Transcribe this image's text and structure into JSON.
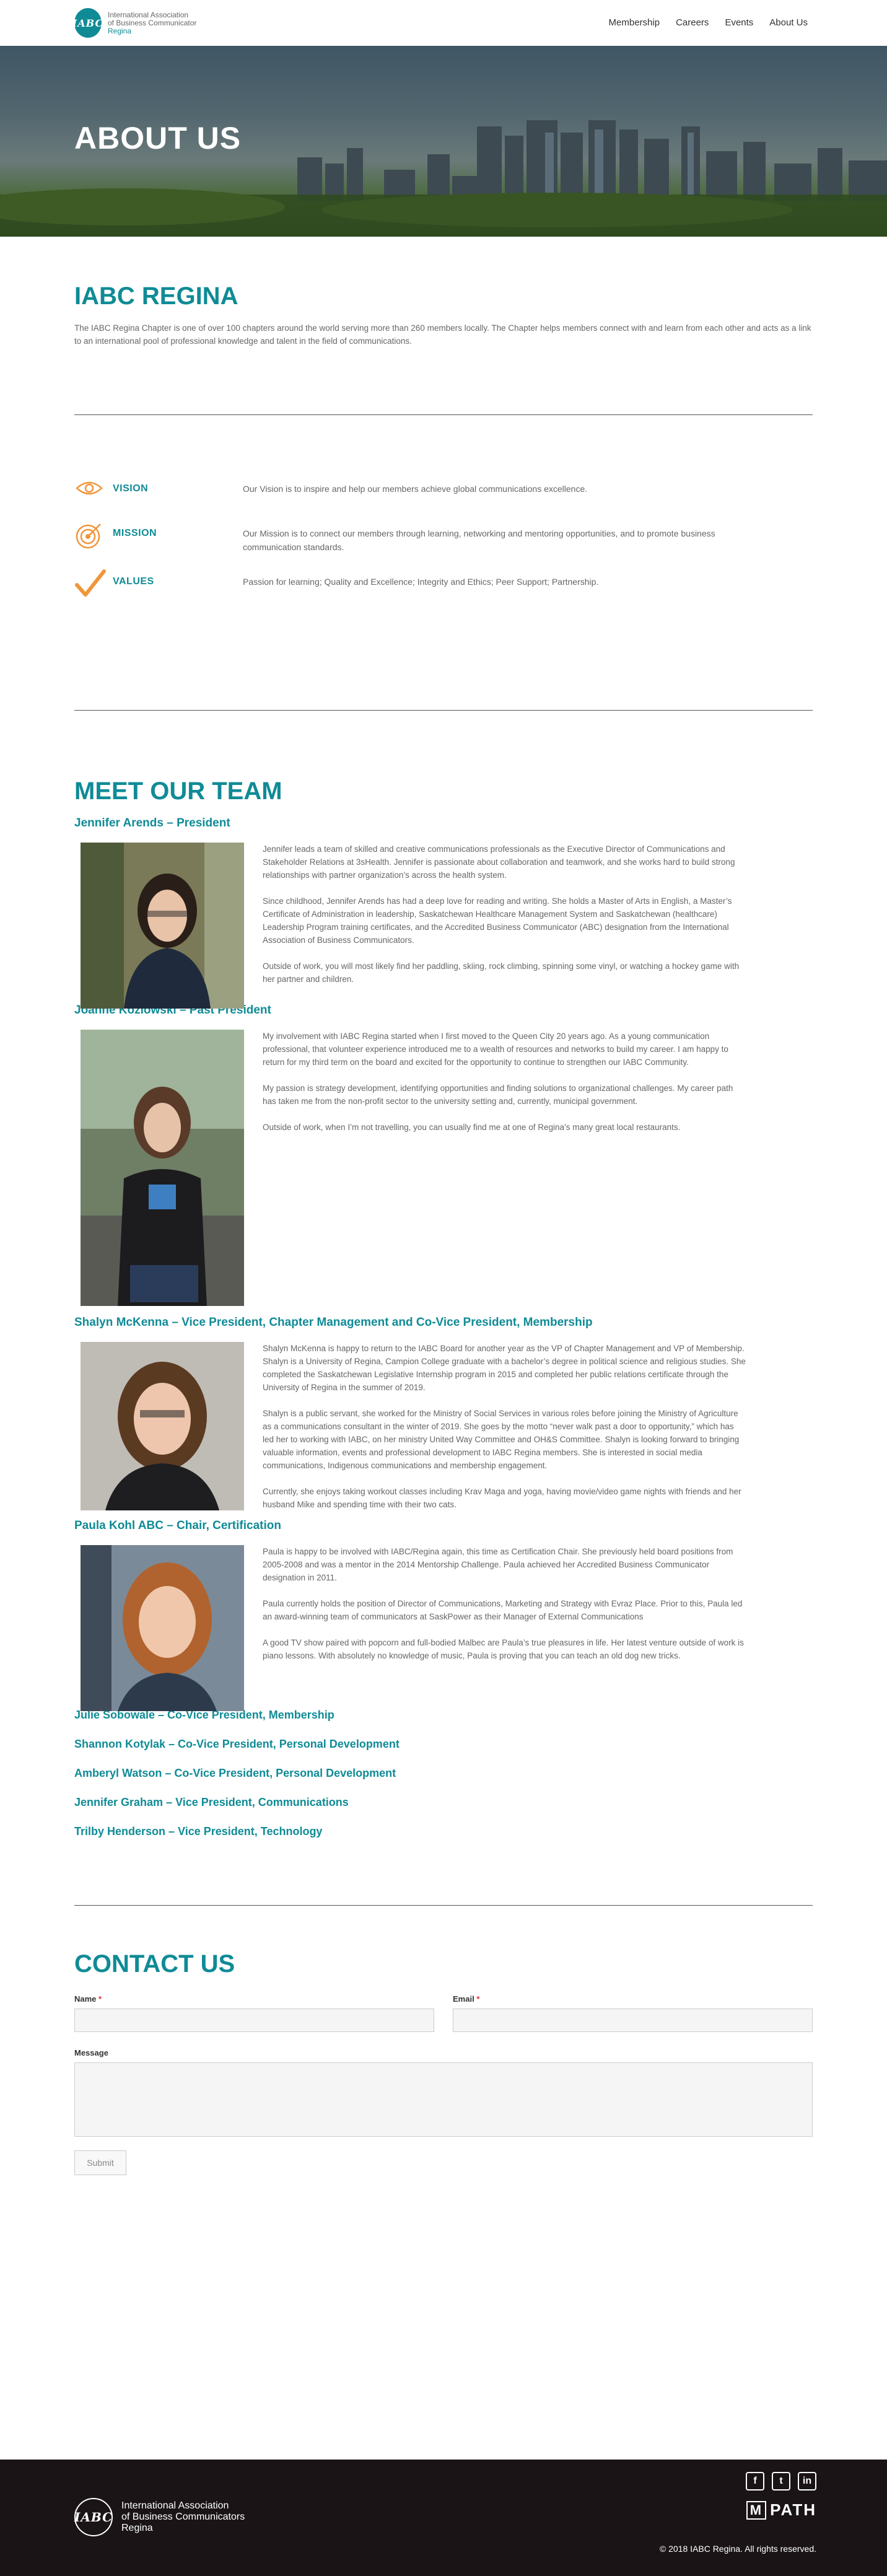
{
  "header": {
    "logo_mark": "IABC",
    "logo_line1": "International Association",
    "logo_line2": "of Business Communicator",
    "logo_line3": "Regina",
    "nav": [
      "Membership",
      "Careers",
      "Events",
      "About Us"
    ]
  },
  "hero": {
    "title": "ABOUT US"
  },
  "iabc": {
    "title": "IABC REGINA",
    "text": "The IABC Regina Chapter is one of over 100 chapters around the world serving more than 260 members locally. The Chapter helps members connect with and learn from each other and acts as a link to an international pool of professional knowledge and talent in the field of communications."
  },
  "vmv": [
    {
      "icon": "eye-icon",
      "label": "VISION",
      "text": "Our Vision is to inspire and help our members achieve global communications excellence."
    },
    {
      "icon": "target-icon",
      "label": "MISSION",
      "text": "Our Mission is to connect our members through learning, networking and mentoring opportunities, and to promote business communication standards."
    },
    {
      "icon": "checkmark-icon",
      "label": "VALUES",
      "text": "Passion for learning; Quality and Excellence; Integrity and Ethics; Peer Support; Partnership."
    }
  ],
  "team": {
    "title": "MEET OUR TEAM",
    "members": [
      {
        "name": "Jennifer Arends – President",
        "bio": [
          "Jennifer leads a team of skilled and creative communications professionals as the Executive Director of Communications and Stakeholder Relations at 3sHealth. Jennifer is passionate about collaboration and teamwork, and she works hard to build strong relationships with partner organization’s across the health system.",
          "Since childhood, Jennifer Arends has had a deep love for reading and writing. She holds a Master of Arts in English, a Master’s Certificate of Administration in leadership, Saskatchewan Healthcare Management System and Saskatchewan (healthcare) Leadership Program training certificates, and the Accredited Business Communicator (ABC) designation from the International Association of Business Communicators.",
          "Outside of work, you will most likely find her paddling, skiing, rock climbing, spinning some vinyl, or watching a hockey game with her partner and children."
        ]
      },
      {
        "name": "Joanne Kozlowski – Past President",
        "bio": [
          "My involvement with IABC Regina started when I first moved to the Queen City 20 years ago. As a young communication professional, that volunteer experience introduced me to a wealth of resources and networks to build my career. I am happy to return for my third term on the board and excited for the opportunity to continue to strengthen our IABC Community.",
          "My passion is strategy development, identifying opportunities and finding solutions to organizational challenges. My career path has taken me from the non-profit sector to the university setting and, currently, municipal government.",
          "Outside of work, when I’m not travelling, you can usually find me at one of Regina’s many great local restaurants."
        ]
      },
      {
        "name": "Shalyn McKenna – Vice President, Chapter Management and Co-Vice President, Membership",
        "bio": [
          "Shalyn McKenna is happy to return to the IABC Board for another year as the VP of Chapter Management and VP of Membership. Shalyn is a University of Regina, Campion College graduate with a bachelor’s degree in political science and religious studies. She completed the Saskatchewan Legislative Internship program in 2015 and completed her public relations certificate through the University of Regina in the summer of 2019.",
          "Shalyn is a public servant, she worked for the Ministry of Social Services in various roles before joining the Ministry of Agriculture as a communications consultant in the winter of 2019. She goes by the motto “never walk past a door to opportunity,” which has led her to working with IABC, on her ministry United Way Committee and OH&S Committee. Shalyn is looking forward to bringing valuable information, events and professional development to IABC Regina members. She is interested in social media communications, Indigenous communications and membership engagement.",
          "Currently, she enjoys taking workout classes including Krav Maga and yoga, having movie/video game nights with friends and her husband Mike and spending time with their two cats."
        ]
      },
      {
        "name": "Paula Kohl ABC – Chair, Certification",
        "bio": [
          "Paula is happy to be involved with IABC/Regina again, this time as Certification Chair. She previously held board positions from 2005-2008 and was a mentor in the 2014 Mentorship Challenge. Paula achieved her Accredited Business Communicator designation in 2011.",
          "Paula currently holds the position of Director of Communications, Marketing and Strategy with Evraz Place. Prior to this, Paula led an award-winning team of communicators at SaskPower as their Manager of External Communications",
          "A good TV show paired with popcorn and full-bodied Malbec are Paula’s true pleasures in life. Her latest venture outside of work is piano lessons. With absolutely no knowledge of music, Paula is proving that you can teach an old dog new tricks."
        ]
      }
    ],
    "others": [
      "Julie Sobowale – Co-Vice President, Membership",
      "Shannon Kotylak – Co-Vice President, Personal Development",
      "Amberyl Watson – Co-Vice President, Personal Development",
      "Jennifer Graham – Vice President, Communications",
      "Trilby Henderson – Vice President, Technology"
    ]
  },
  "contact": {
    "title": "CONTACT US",
    "name_label": "Name",
    "email_label": "Email",
    "required_mark": "*",
    "message_label": "Message",
    "submit_label": "Submit"
  },
  "footer": {
    "logo_mark": "IABC",
    "line1": "International Association",
    "line2": "of Business Communicators",
    "line3": "Regina",
    "social": [
      {
        "icon": "facebook-icon",
        "glyph": "f"
      },
      {
        "icon": "twitter-icon",
        "glyph": "t"
      },
      {
        "icon": "linkedin-icon",
        "glyph": "in"
      }
    ],
    "mpath_m": "M",
    "mpath_rest": "PATH",
    "copyright": "© 2018 IABC Regina. All rights reserved."
  },
  "colors": {
    "accent": "#0f8b96",
    "icon_orange": "#f0963a",
    "footer_bg": "#1a1417"
  }
}
